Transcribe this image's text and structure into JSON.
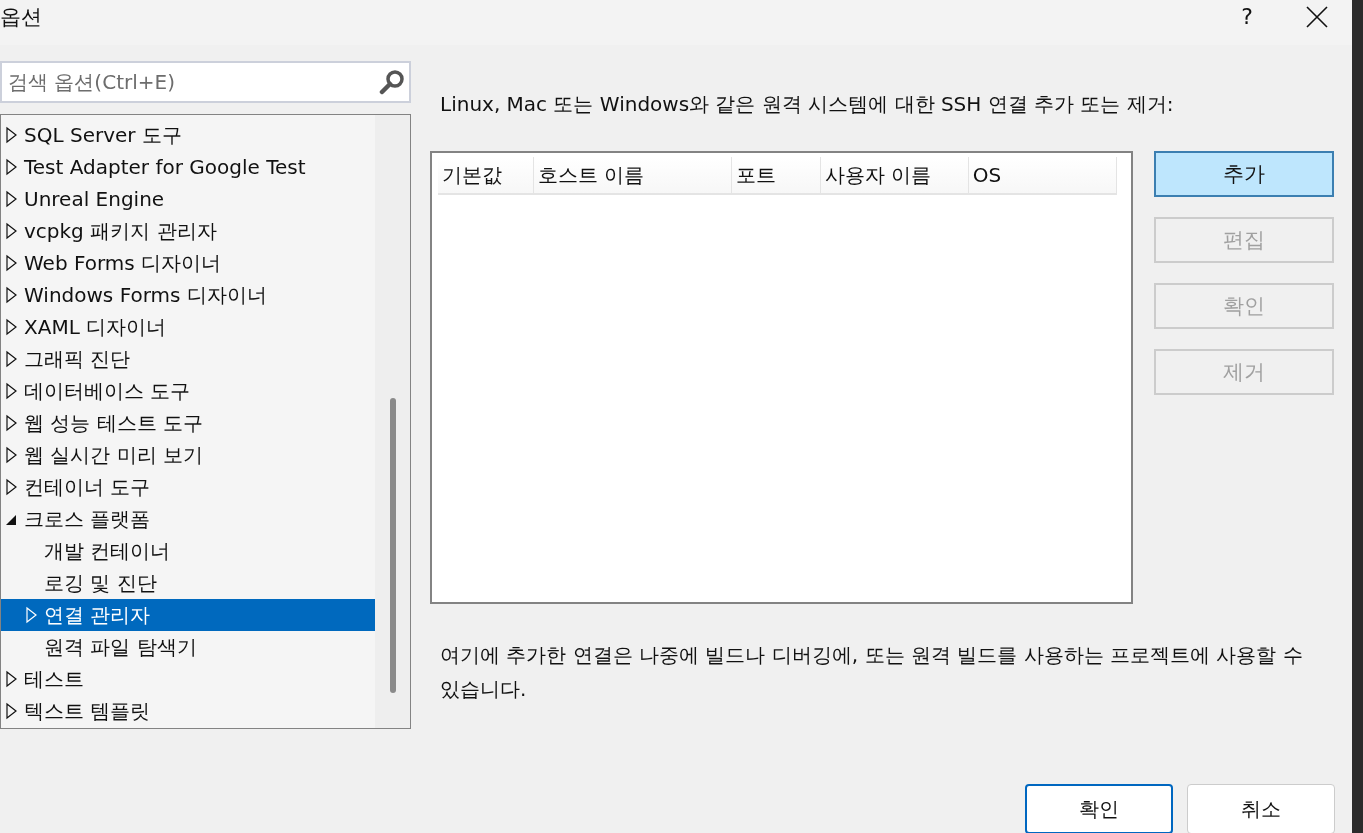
{
  "window": {
    "title": "옵션",
    "help": "?"
  },
  "search": {
    "placeholder": "검색 옵션(Ctrl+E)"
  },
  "tree": [
    {
      "label": "SQL Server 도구",
      "kind": "branch",
      "expanded": false,
      "selected": false
    },
    {
      "label": "Test Adapter for Google Test",
      "kind": "branch",
      "expanded": false,
      "selected": false
    },
    {
      "label": "Unreal Engine",
      "kind": "branch",
      "expanded": false,
      "selected": false
    },
    {
      "label": "vcpkg 패키지 관리자",
      "kind": "branch",
      "expanded": false,
      "selected": false
    },
    {
      "label": "Web Forms 디자이너",
      "kind": "branch",
      "expanded": false,
      "selected": false
    },
    {
      "label": "Windows Forms 디자이너",
      "kind": "branch",
      "expanded": false,
      "selected": false
    },
    {
      "label": "XAML 디자이너",
      "kind": "branch",
      "expanded": false,
      "selected": false
    },
    {
      "label": "그래픽 진단",
      "kind": "branch",
      "expanded": false,
      "selected": false
    },
    {
      "label": "데이터베이스 도구",
      "kind": "branch",
      "expanded": false,
      "selected": false
    },
    {
      "label": "웹 성능 테스트 도구",
      "kind": "branch",
      "expanded": false,
      "selected": false
    },
    {
      "label": "웹 실시간 미리 보기",
      "kind": "branch",
      "expanded": false,
      "selected": false
    },
    {
      "label": "컨테이너 도구",
      "kind": "branch",
      "expanded": false,
      "selected": false
    },
    {
      "label": "크로스 플랫폼",
      "kind": "branch",
      "expanded": true,
      "selected": false,
      "children": [
        {
          "label": "개발 컨테이너",
          "kind": "leaf",
          "selected": false
        },
        {
          "label": "로깅 및 진단",
          "kind": "leaf",
          "selected": false
        },
        {
          "label": "연결 관리자",
          "kind": "branch",
          "expanded": false,
          "selected": true
        },
        {
          "label": "원격 파일 탐색기",
          "kind": "leaf",
          "selected": false
        }
      ]
    },
    {
      "label": "테스트",
      "kind": "branch",
      "expanded": false,
      "selected": false
    },
    {
      "label": "텍스트 템플릿",
      "kind": "branch",
      "expanded": false,
      "selected": false
    }
  ],
  "description": "Linux, Mac 또는 Windows와 같은 원격 시스템에 대한 SSH 연결 추가 또는 제거:",
  "table": {
    "columns": [
      "기본값",
      "호스트 이름",
      "포트",
      "사용자 이름",
      "OS"
    ]
  },
  "side_buttons": [
    {
      "label": "추가",
      "disabled": false
    },
    {
      "label": "편집",
      "disabled": true
    },
    {
      "label": "확인",
      "disabled": true
    },
    {
      "label": "제거",
      "disabled": true
    }
  ],
  "note": "여기에 추가한 연결은 나중에 빌드나 디버깅에, 또는 원격 빌드를 사용하는 프로젝트에 사용할 수 있습니다.",
  "footer_buttons": [
    {
      "label": "확인",
      "kind": "default"
    },
    {
      "label": "취소",
      "kind": "normal"
    }
  ]
}
